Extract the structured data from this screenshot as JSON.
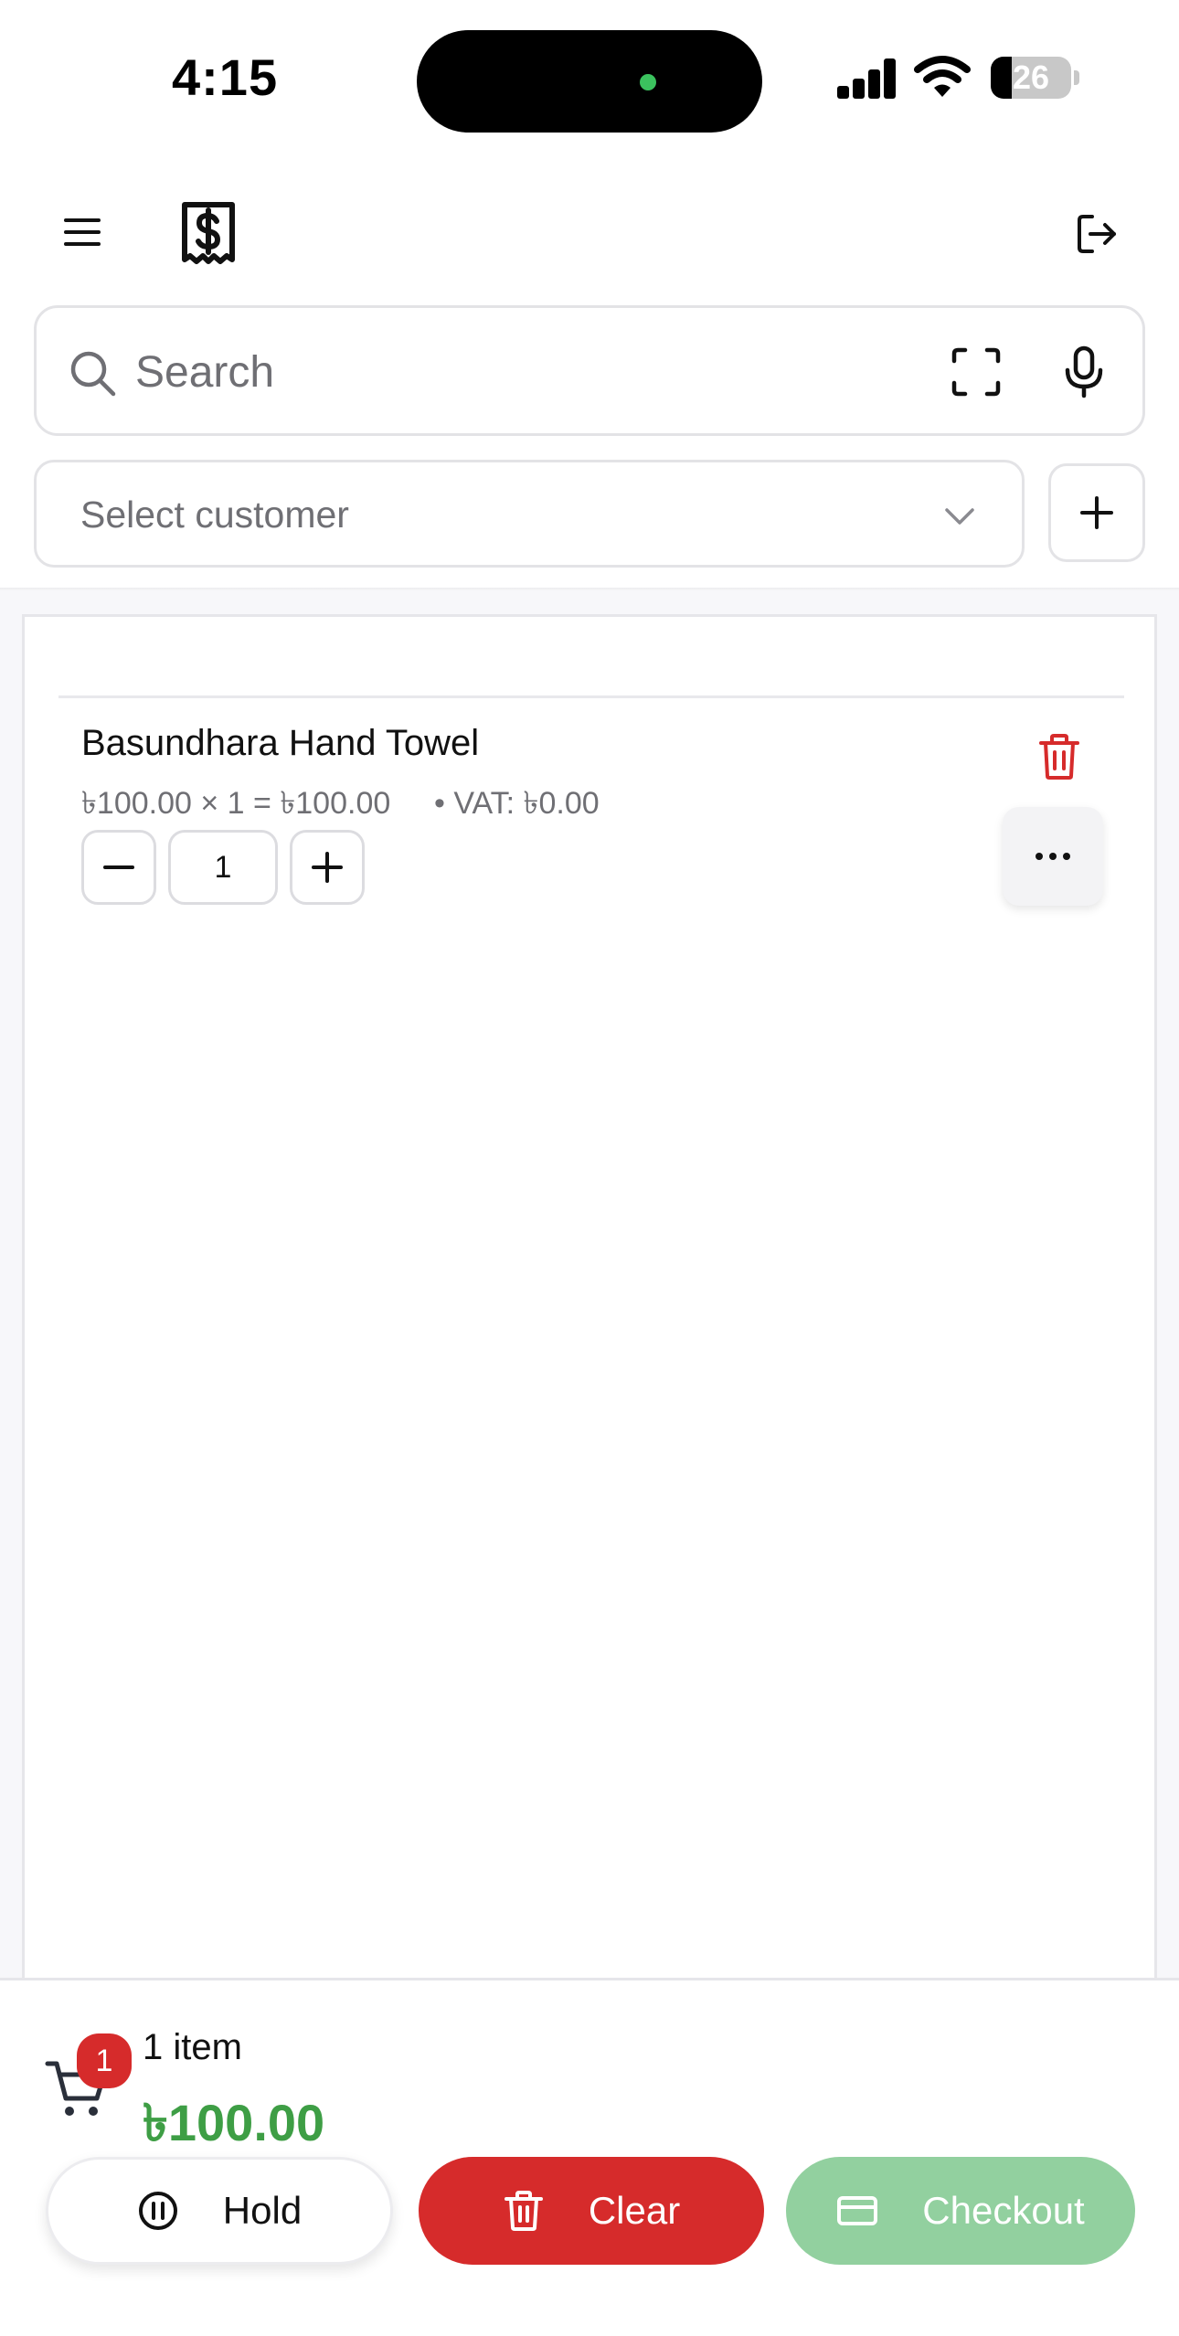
{
  "status_bar": {
    "time": "4:15",
    "battery_level": "26",
    "battery_percent": 26
  },
  "header": {
    "menu_icon": "menu-icon",
    "logo_icon": "receipt-dollar-icon",
    "logout_icon": "logout-icon"
  },
  "search": {
    "placeholder": "Search",
    "value": ""
  },
  "customer": {
    "placeholder": "Select customer"
  },
  "cart": {
    "items": [
      {
        "name": "Basundhara Hand Towel",
        "price_line": "৳100.00 × 1 = ৳100.00",
        "vat_line": "• VAT: ৳0.00",
        "quantity": "1"
      }
    ]
  },
  "summary": {
    "badge_count": "1",
    "item_count": "1 item",
    "total": "৳100.00"
  },
  "actions": {
    "hold_label": "Hold",
    "clear_label": "Clear",
    "checkout_label": "Checkout"
  },
  "colors": {
    "accent_green": "#3e9e45",
    "danger_red": "#d62b2b",
    "checkout_disabled": "#92d09f"
  }
}
